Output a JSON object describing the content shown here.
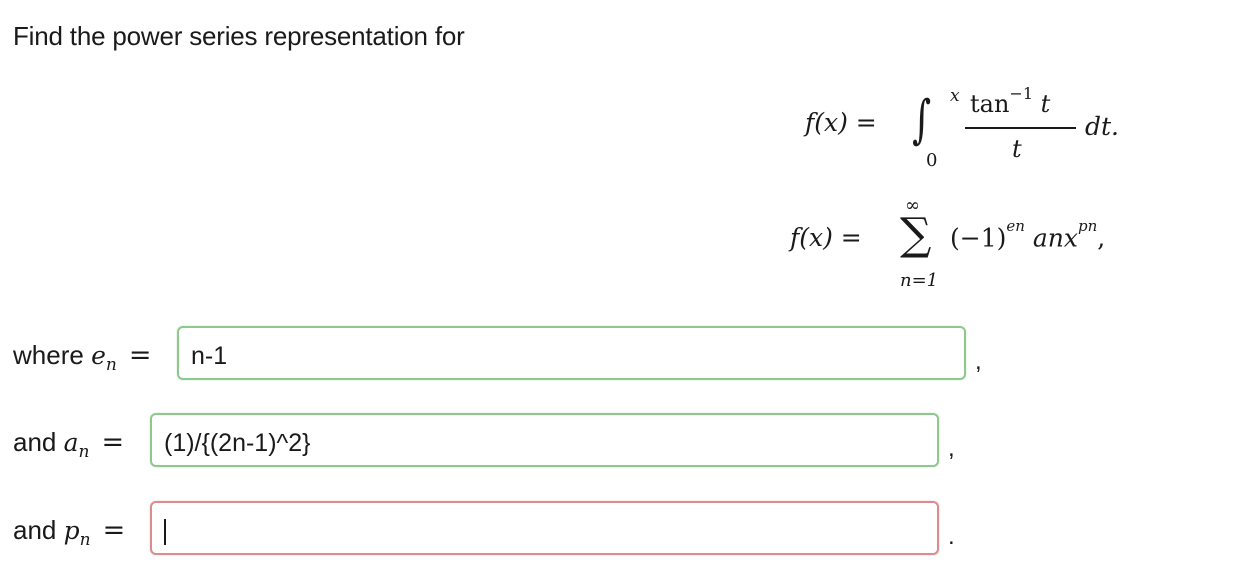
{
  "question": {
    "prompt": "Find the power series representation for"
  },
  "equation1": {
    "lhs": "f(x) =",
    "upper_limit": "x",
    "lower_limit": "0",
    "numerator_func": "tan",
    "numerator_exp": "−1",
    "numerator_var": "t",
    "denominator": "t",
    "differential": "dt."
  },
  "equation2": {
    "lhs": "f(x) =",
    "sum_upper": "∞",
    "sum_lower": "n=1",
    "base": "(−1)",
    "exp_e": "en",
    "coef": "an",
    "var": "x",
    "exp_p": "pn",
    "trail": ","
  },
  "rows": [
    {
      "label_text": "where",
      "var_letter": "e",
      "var_sub": "n",
      "eq": "=",
      "value": "n-1",
      "status": "correct",
      "trail": ","
    },
    {
      "label_text": "and",
      "var_letter": "a",
      "var_sub": "n",
      "eq": "=",
      "value": "(1)/{(2n-1)^2}",
      "status": "correct",
      "trail": ","
    },
    {
      "label_text": "and",
      "var_letter": "p",
      "var_sub": "n",
      "eq": "=",
      "value": "",
      "status": "incorrect",
      "trail": "."
    }
  ],
  "colors": {
    "correct_border": "#8fc88c",
    "incorrect_border": "#d98d8d"
  }
}
